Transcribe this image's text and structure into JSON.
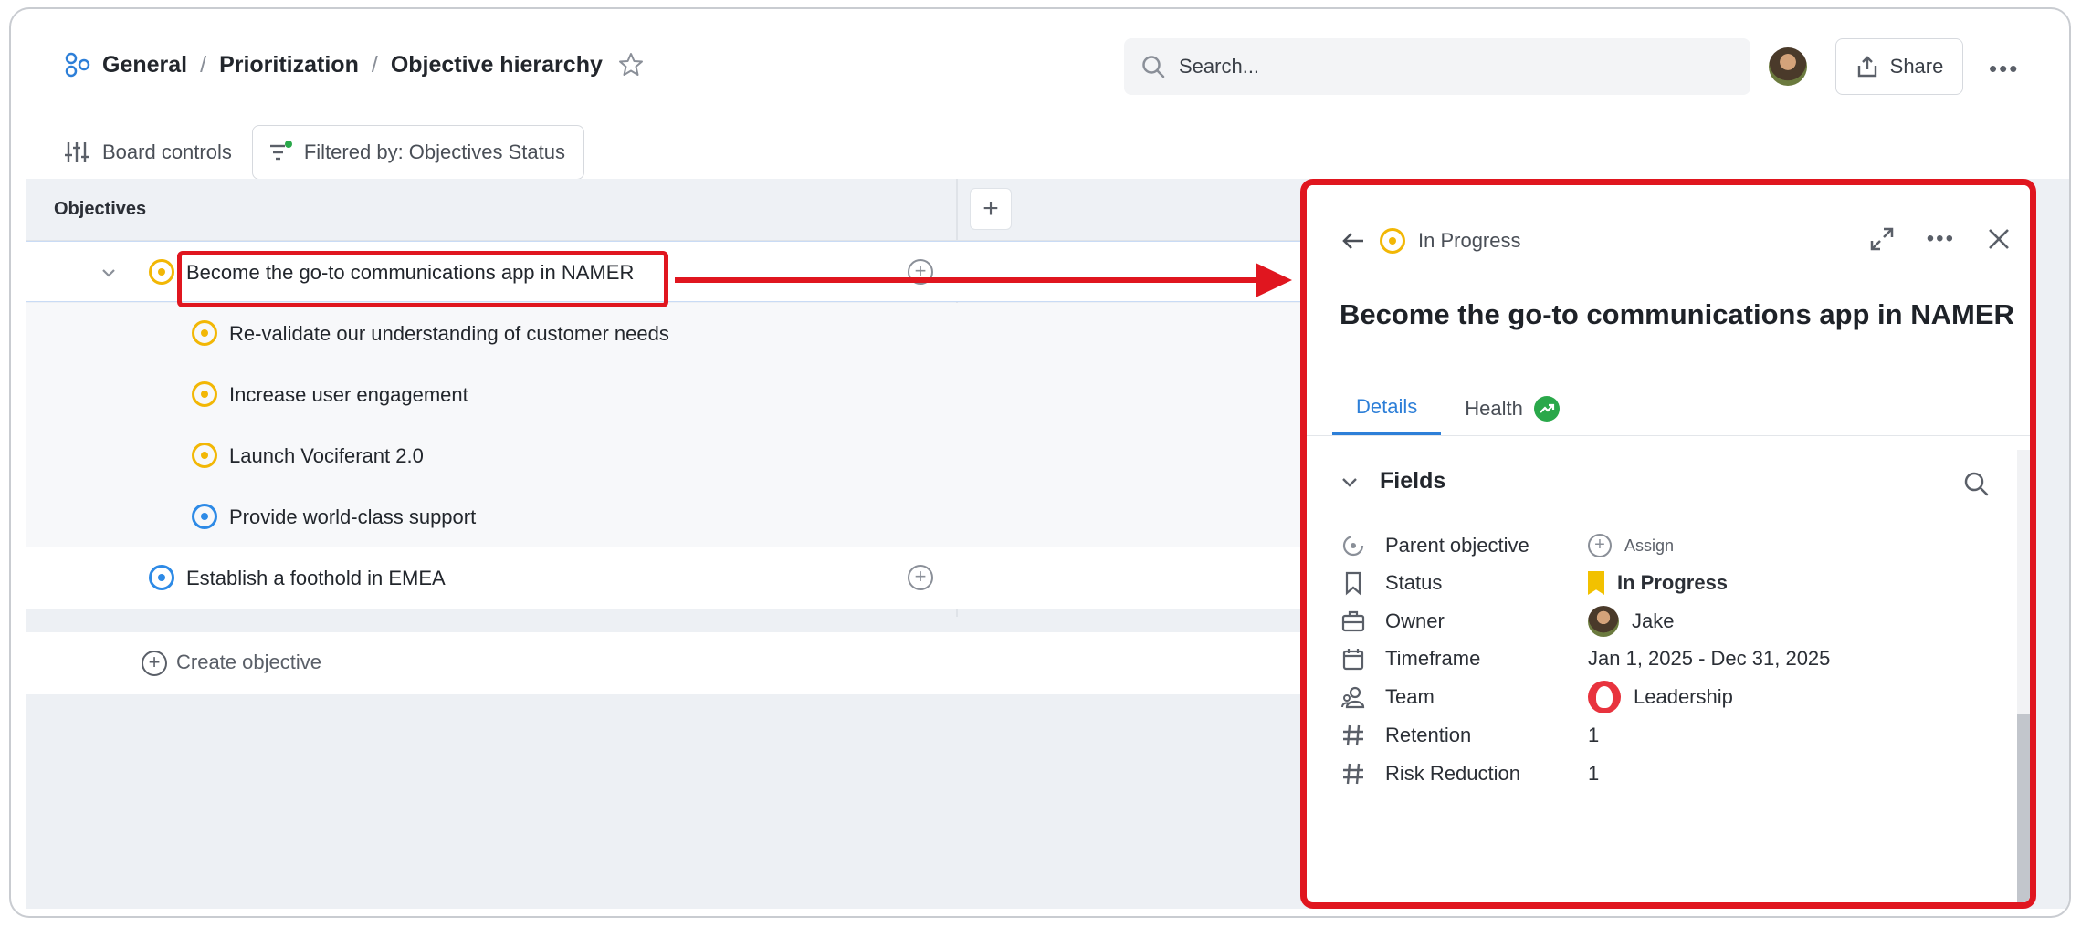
{
  "breadcrumb": {
    "items": [
      "General",
      "Prioritization",
      "Objective hierarchy"
    ],
    "separator": "/"
  },
  "search": {
    "placeholder": "Search..."
  },
  "header": {
    "share_label": "Share"
  },
  "toolbar": {
    "board_controls_label": "Board controls",
    "filter_label": "Filtered by: Objectives Status"
  },
  "board": {
    "column_header": "Objectives",
    "rows": [
      {
        "label": "Become the go-to communications app in NAMER",
        "status": "in-progress"
      },
      {
        "label": "Re-validate our understanding of customer needs",
        "status": "in-progress"
      },
      {
        "label": "Increase user engagement",
        "status": "in-progress"
      },
      {
        "label": "Launch Vociferant 2.0",
        "status": "in-progress"
      },
      {
        "label": "Provide world-class support",
        "status": "planned"
      },
      {
        "label": "Establish a foothold in EMEA",
        "status": "planned"
      }
    ],
    "create_label": "Create objective"
  },
  "panel": {
    "status_label": "In Progress",
    "title": "Become the go-to communications app in NAMER",
    "tabs": [
      {
        "label": "Details"
      },
      {
        "label": "Health"
      }
    ],
    "fields_label": "Fields",
    "fields": [
      {
        "name": "Parent objective",
        "value": "Assign"
      },
      {
        "name": "Status",
        "value": "In Progress"
      },
      {
        "name": "Owner",
        "value": "Jake"
      },
      {
        "name": "Timeframe",
        "value": "Jan 1, 2025 - Dec 31, 2025"
      },
      {
        "name": "Team",
        "value": "Leadership"
      },
      {
        "name": "Retention",
        "value": "1"
      },
      {
        "name": "Risk Reduction",
        "value": "1"
      }
    ]
  },
  "colors": {
    "accent": "#2d7fd8",
    "in_progress": "#f2b705",
    "planned": "#2d8ae6",
    "annotation": "#e0161f",
    "health": "#2aa84a"
  }
}
